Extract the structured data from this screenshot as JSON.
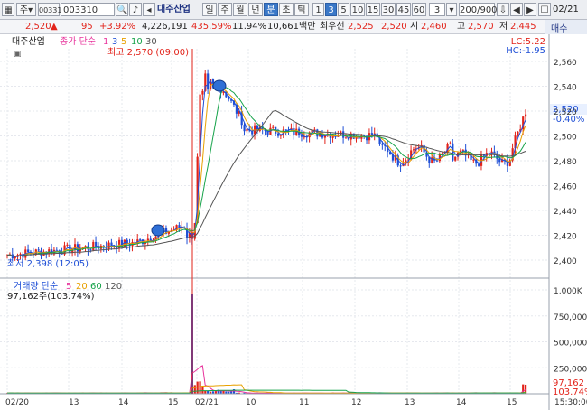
{
  "toolbar": {
    "field1": "주",
    "field2": "00331",
    "field3": "003310",
    "company": "대주산업",
    "periods": [
      "일",
      "주",
      "월",
      "년",
      "분",
      "초",
      "틱"
    ],
    "active_period": "분",
    "intervals": [
      "1",
      "3",
      "5",
      "10",
      "15",
      "30",
      "45",
      "60"
    ],
    "active_interval": "3",
    "interval_select": "3",
    "range": "200/900"
  },
  "quote": {
    "price": "2,520",
    "arrow": "▲",
    "change": "95",
    "change_pct": "+3.92%",
    "volume": "4,226,191",
    "vol_pct": "435.59%",
    "turnover": "11.94%",
    "amount": "10,661백만",
    "best_label": "최우선",
    "best_ask": "2,525",
    "best_bid": "2,520",
    "open_label": "시",
    "open": "2,460",
    "high_label": "고",
    "high": "2,570",
    "low_label": "저",
    "low": "2,445",
    "date": "02/21",
    "sell_label": "매수"
  },
  "price_panel": {
    "name": "대주산업",
    "legend_label": "종가 단순",
    "ma_periods": [
      "1",
      "3",
      "5",
      "10",
      "30"
    ],
    "high_annot": "최고 2,570 (09:00)",
    "low_annot": "최저 2,398 (12:05)",
    "lc": "LC:5.22",
    "hc": "HC:-1.95",
    "current_price": "2,520",
    "current_pct": "-0.40%",
    "y_ticks": [
      "2,560",
      "2,540",
      "2,520",
      "2,500",
      "2,480",
      "2,460",
      "2,440",
      "2,420",
      "2,400"
    ]
  },
  "volume_panel": {
    "legend_label": "거래량 단순",
    "ma_periods": [
      "5",
      "20",
      "60",
      "120"
    ],
    "current_volume": "97,162주(103.74%)",
    "y_ticks": [
      "1,000K",
      "750,000",
      "500,000",
      "250,000"
    ],
    "last_value": "97,162",
    "last_pct": "103.74%"
  },
  "x_axis": {
    "labels": [
      "02/20",
      "13",
      "14",
      "15",
      "02/21",
      "10",
      "11",
      "12",
      "13",
      "14",
      "15",
      "15:30:00"
    ]
  },
  "colors": {
    "up": "#e2231a",
    "down": "#1f4fd6",
    "ma1": "#e8339c",
    "ma3": "#1f4fd6",
    "ma5": "#e8a000",
    "ma10": "#16a34a",
    "ma30": "#555555"
  },
  "chart_data": {
    "type": "candlestick",
    "sessions": [
      "02/20",
      "02/21"
    ],
    "open": 2460,
    "high": 2570,
    "low": 2445,
    "close": 2520,
    "prev_close": 2425,
    "ylim": [
      2398,
      2570
    ]
  }
}
